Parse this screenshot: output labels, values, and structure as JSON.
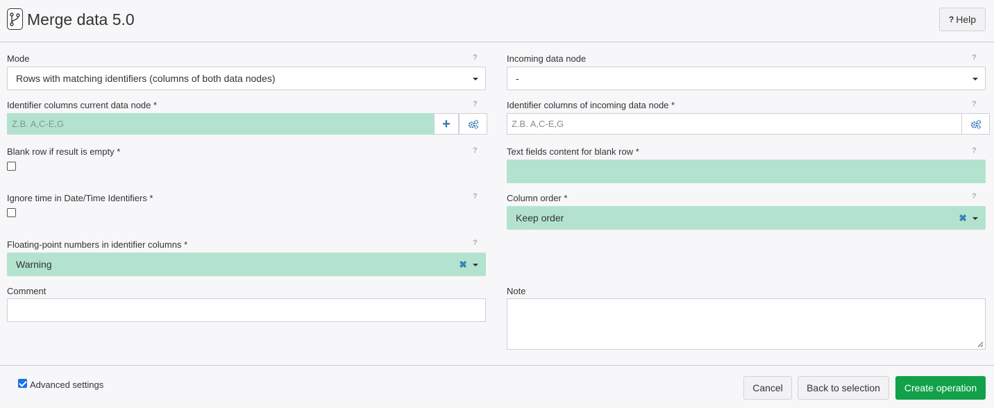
{
  "header": {
    "title": "Merge data 5.0",
    "help_label": "Help"
  },
  "fields": {
    "mode": {
      "label": "Mode",
      "value": "Rows with matching identifiers (columns of both data nodes)"
    },
    "incoming_node": {
      "label": "Incoming data node",
      "value": "-"
    },
    "id_cols_current": {
      "label": "Identifier columns current data node *",
      "placeholder": "Z.B. A,C-E,G"
    },
    "id_cols_incoming": {
      "label": "Identifier columns of incoming data node *",
      "placeholder": "Z.B. A,C-E,G"
    },
    "blank_row": {
      "label": "Blank row if result is empty *",
      "checked": false
    },
    "text_blank_row": {
      "label": "Text fields content for blank row *",
      "value": ""
    },
    "ignore_time": {
      "label": "Ignore time in Date/Time Identifiers *",
      "checked": false
    },
    "column_order": {
      "label": "Column order *",
      "value": "Keep order"
    },
    "float_numbers": {
      "label": "Floating-point numbers in identifier columns *",
      "value": "Warning"
    },
    "comment": {
      "label": "Comment",
      "value": ""
    },
    "note": {
      "label": "Note",
      "value": ""
    }
  },
  "help_mark": "?",
  "footer": {
    "advanced_label": "Advanced settings",
    "advanced_checked": true,
    "cancel_label": "Cancel",
    "back_label": "Back to selection",
    "create_label": "Create operation"
  },
  "colors": {
    "field_highlight": "#b3e3ce",
    "primary": "#12a14a",
    "icon_blue": "#2f78b5"
  }
}
